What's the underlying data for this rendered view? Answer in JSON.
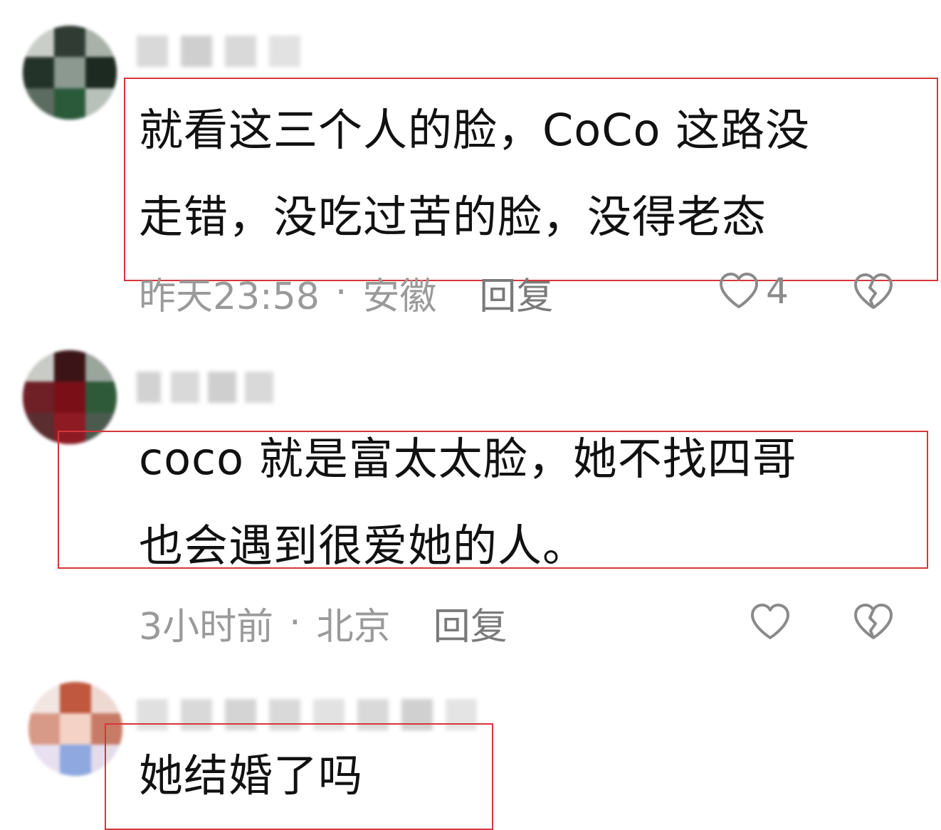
{
  "comments": [
    {
      "text": "就看这三个人的脸，CoCo 这路没\n走错，没吃过苦的脸，没得老态",
      "time": "昨天23:58",
      "location": "安徽",
      "reply_label": "回复",
      "like_count": "4"
    },
    {
      "text": "coco 就是富太太脸，她不找四哥\n也会遇到很爱她的人。",
      "time": "3小时前",
      "location": "北京",
      "reply_label": "回复",
      "like_count": ""
    },
    {
      "text": "她结婚了吗"
    }
  ],
  "meta_separator": "·",
  "colors": {
    "highlight_border": "#d8363a",
    "meta_text": "#9a9a9a",
    "content_text": "#111111"
  },
  "icons": {
    "like": "heart-outline-icon",
    "dislike": "broken-heart-icon"
  }
}
